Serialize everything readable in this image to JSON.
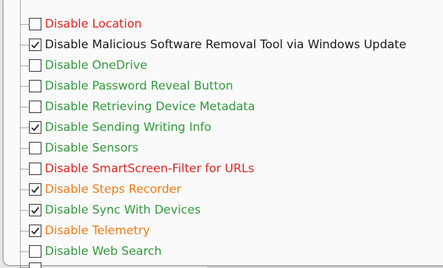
{
  "colors": {
    "red": "#e3231f",
    "green": "#2f9a3a",
    "orange": "#f07a14",
    "black": "#1a1a1a"
  },
  "options": [
    {
      "label": "Disable Location",
      "checked": false,
      "color": "red"
    },
    {
      "label": "Disable Malicious Software Removal Tool via Windows Update",
      "checked": true,
      "color": "black"
    },
    {
      "label": "Disable OneDrive",
      "checked": false,
      "color": "green"
    },
    {
      "label": "Disable Password Reveal Button",
      "checked": false,
      "color": "green"
    },
    {
      "label": "Disable Retrieving Device Metadata",
      "checked": false,
      "color": "green"
    },
    {
      "label": "Disable Sending Writing Info",
      "checked": true,
      "color": "green"
    },
    {
      "label": "Disable Sensors",
      "checked": false,
      "color": "green"
    },
    {
      "label": "Disable SmartScreen-Filter for URLs",
      "checked": false,
      "color": "red"
    },
    {
      "label": "Disable Steps Recorder",
      "checked": true,
      "color": "orange"
    },
    {
      "label": "Disable Sync With Devices",
      "checked": true,
      "color": "green"
    },
    {
      "label": "Disable Telemetry",
      "checked": true,
      "color": "orange"
    },
    {
      "label": "Disable Web Search",
      "checked": false,
      "color": "green"
    }
  ],
  "icons": {
    "check": "check-icon"
  }
}
